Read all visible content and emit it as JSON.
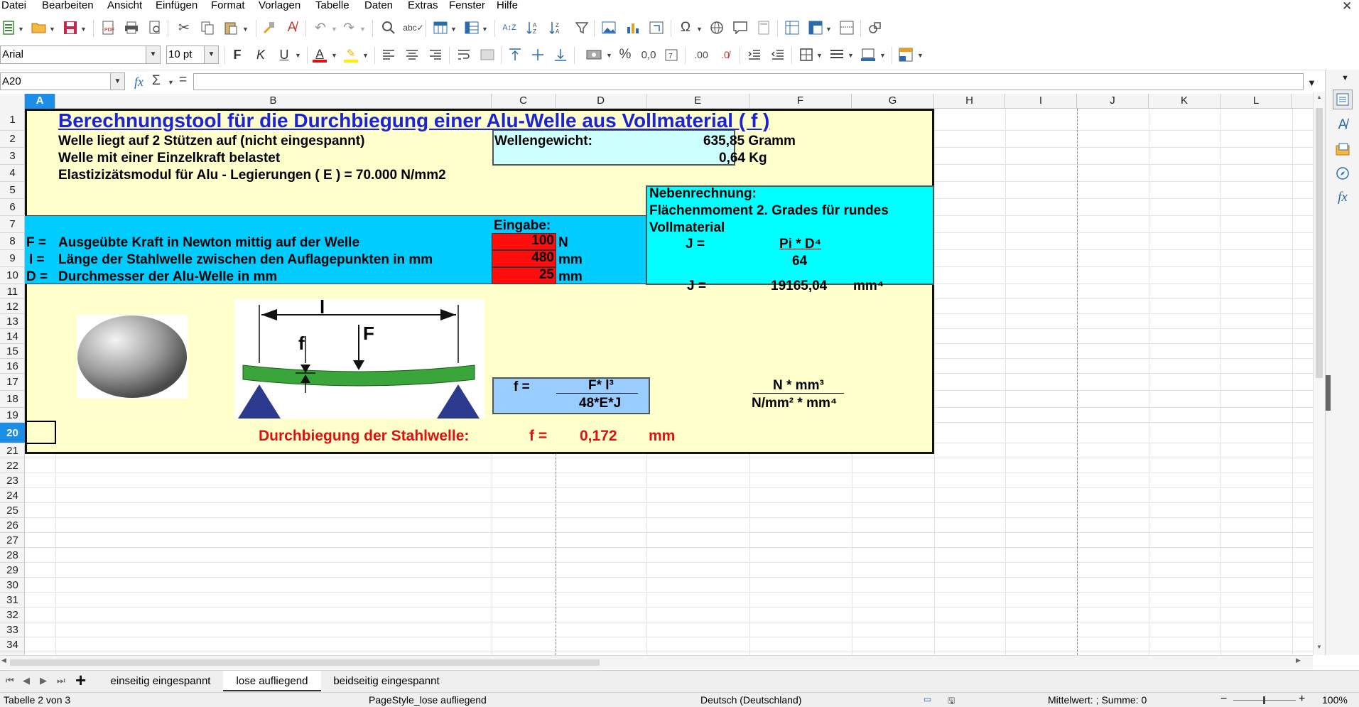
{
  "menu": {
    "items": [
      "Datei",
      "Bearbeiten",
      "Ansicht",
      "Einfügen",
      "Format",
      "Vorlagen",
      "Tabelle",
      "Daten",
      "Extras",
      "Fenster",
      "Hilfe"
    ]
  },
  "font_name": "Arial",
  "font_size": "10 pt",
  "name_box": "A20",
  "formula": {
    "fx": "fx",
    "sum": "Σ",
    "eq": "="
  },
  "columns": [
    "A",
    "B",
    "C",
    "D",
    "E",
    "F",
    "G",
    "H",
    "I",
    "J",
    "K",
    "L"
  ],
  "rows": [
    "1",
    "2",
    "3",
    "4",
    "5",
    "6",
    "7",
    "8",
    "9",
    "10",
    "11",
    "12",
    "13",
    "14",
    "15",
    "16",
    "17",
    "18",
    "19",
    "20",
    "21",
    "22",
    "23",
    "24",
    "25",
    "26",
    "27",
    "28",
    "29",
    "30",
    "31",
    "32",
    "33",
    "34"
  ],
  "sheet": {
    "title": "Berechnungstool für die Durchbiegung einer Alu-Welle aus Vollmaterial ( f )",
    "line1": "Welle liegt auf 2 Stützen auf (nicht eingespannt)",
    "line2": "Welle mit einer Einzelkraft belastet",
    "line3": "Elastizizätsmodul für Alu - Legierungen ( E ) = 70.000 N/mm2",
    "weight_label": "Wellengewicht:",
    "weight_gramm": "635,85 Gramm",
    "weight_kg": "0,64 Kg",
    "neben_title": "Nebenrechnung:",
    "neben_sub1": "Flächenmoment 2. Grades für rundes",
    "neben_sub2": "Vollmaterial",
    "j_label": "J =",
    "j_num": "Pi * D⁴",
    "j_den": "64",
    "j_label2": "J =",
    "j_value": "19165,04",
    "j_unit": "mm⁴",
    "eingabe": "Eingabe:",
    "inputs": [
      {
        "sym": "F =",
        "desc": "Ausgeübte Kraft in Newton mittig auf der Welle",
        "value": "100",
        "unit": "N"
      },
      {
        "sym": "l =",
        "desc": "Länge der Stahlwelle zwischen den Auflagepunkten in mm",
        "value": "480",
        "unit": "mm"
      },
      {
        "sym": "D =",
        "desc": "Durchmesser der Alu-Welle in mm",
        "value": "25",
        "unit": "mm"
      }
    ],
    "diagram_l": "l",
    "diagram_f": "f",
    "diagram_F": "F",
    "formula_f": "f =",
    "formula_num": "F* l³",
    "formula_den": "48*E*J",
    "unit_num": "N * mm³",
    "unit_den": "N/mm² * mm⁴",
    "result_label": "Durchbiegung der Stahlwelle:",
    "result_f": "f =",
    "result_value": "0,172",
    "result_unit": "mm"
  },
  "tabs": [
    "einseitig eingespannt",
    "lose aufliegend",
    "beidseitig eingespannt"
  ],
  "status": {
    "sheet": "Tabelle 2 von 3",
    "pagestyle": "PageStyle_lose aufliegend",
    "language": "Deutsch (Deutschland)",
    "sum": "Mittelwert: ; Summe: 0",
    "zoom": "100%"
  },
  "colors": {
    "title_blue": "#1a23d6",
    "panel_yellow": "#ffffcc",
    "panel_blue": "#00ccff",
    "cyan": "#00ffff",
    "light_blue": "#99ccff",
    "input_red": "#ff0d0d",
    "result_red": "#e01010",
    "beam_green": "#3aa53a",
    "support_blue": "#2b3a8c",
    "select_blue": "#1b8ee8"
  }
}
